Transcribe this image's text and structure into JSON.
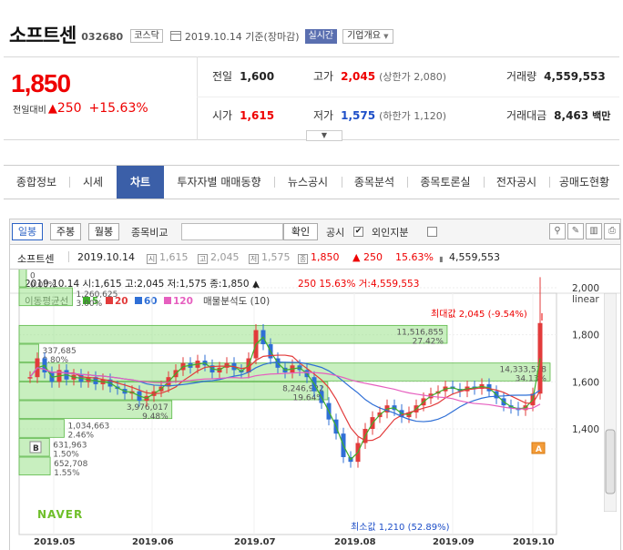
{
  "header": {
    "company_name": "소프트센",
    "code": "032680",
    "market": "코스닥",
    "date_basis": "2019.10.14 기준(장마감)",
    "realtime_label": "실시간",
    "company_info_label": "기업개요"
  },
  "quote": {
    "current_price": "1,850",
    "change_label": "전일대비",
    "change_arrow": "▲",
    "change_value": "250",
    "change_rate": "+15.63%",
    "prev_close_label": "전일",
    "prev_close": "1,600",
    "high_label": "고가",
    "high": "2,045",
    "high_limit": "(상한가 2,080)",
    "volume_label": "거래량",
    "volume": "4,559,553",
    "open_label": "시가",
    "open": "1,615",
    "low_label": "저가",
    "low": "1,575",
    "low_limit": "(하한가 1,120)",
    "turnover_label": "거래대금",
    "turnover": "8,463",
    "turnover_unit": "백만"
  },
  "tabs": [
    {
      "label": "종합정보",
      "active": false
    },
    {
      "label": "시세",
      "active": false
    },
    {
      "label": "차트",
      "active": true
    },
    {
      "label": "투자자별 매매동향",
      "active": false
    },
    {
      "label": "뉴스공시",
      "active": false
    },
    {
      "label": "종목분석",
      "active": false
    },
    {
      "label": "종목토론실",
      "active": false
    },
    {
      "label": "전자공시",
      "active": false
    },
    {
      "label": "공매도현황",
      "active": false
    }
  ],
  "toolbar": {
    "daily": "일봉",
    "weekly": "주봉",
    "monthly": "월봉",
    "compare_label": "종목비교",
    "confirm": "확인",
    "public_label": "공시",
    "foreign_label": "외인지분",
    "public_checked": true,
    "foreign_checked": false
  },
  "info_bar": {
    "name": "소프트센",
    "date": "2019.10.14",
    "open_icon": "시",
    "open": "1,615",
    "high_icon": "고",
    "high": "2,045",
    "low_icon": "저",
    "low": "1,575",
    "close_icon": "종",
    "close": "1,850",
    "change": "▲ 250",
    "rate": "15.63%",
    "volume_icon": "거래량-icon",
    "volume": "4,559,553"
  },
  "chart_data": {
    "type": "candlestick",
    "ohlc_line": "2019.10.14 시:1,615 고:2,045 저:1,575 종:1,850 ▲",
    "ohlc_change": "250  15.63% 거:4,559,553",
    "ma_label": "이동평균선",
    "ma_series": [
      {
        "name": "5",
        "color": "#3fae2a"
      },
      {
        "name": "20",
        "color": "#e23b3b"
      },
      {
        "name": "60",
        "color": "#2f6fd6"
      },
      {
        "name": "120",
        "color": "#e65fbf"
      }
    ],
    "volume_profile_label": "매물분석도 (10)",
    "scale_label": "linear",
    "y_ticks": [
      1400,
      1600,
      1800,
      2000
    ],
    "x_ticks": [
      "2019.05",
      "2019.06",
      "2019.07",
      "2019.08",
      "2019.09",
      "2019.10"
    ],
    "max_label": "최대값 2,045 (-9.54%)",
    "min_label": "최소값 1,210 (52.89%)",
    "volume_profile": [
      {
        "vol": "0",
        "pct": "0.00%",
        "share": 0.0
      },
      {
        "vol": "1,260,625",
        "pct": "3.00%",
        "share": 3.0
      },
      {
        "vol": "11,516,855",
        "pct": "27.42%",
        "share": 27.42
      },
      {
        "vol": "337,685",
        "pct": "0.80%",
        "share": 0.8
      },
      {
        "vol": "14,333,538",
        "pct": "34.13%",
        "share": 34.13
      },
      {
        "vol": "8,246,922",
        "pct": "19.64%",
        "share": 19.64
      },
      {
        "vol": "3,976,017",
        "pct": "9.48%",
        "share": 9.48
      },
      {
        "vol": "1,034,663",
        "pct": "2.46%",
        "share": 2.46
      },
      {
        "vol": "631,963",
        "pct": "1.50%",
        "share": 1.5
      },
      {
        "vol": "652,708",
        "pct": "1.55%",
        "share": 1.55
      }
    ],
    "markers": [
      "B",
      "A"
    ],
    "watermark": "NAVER"
  }
}
